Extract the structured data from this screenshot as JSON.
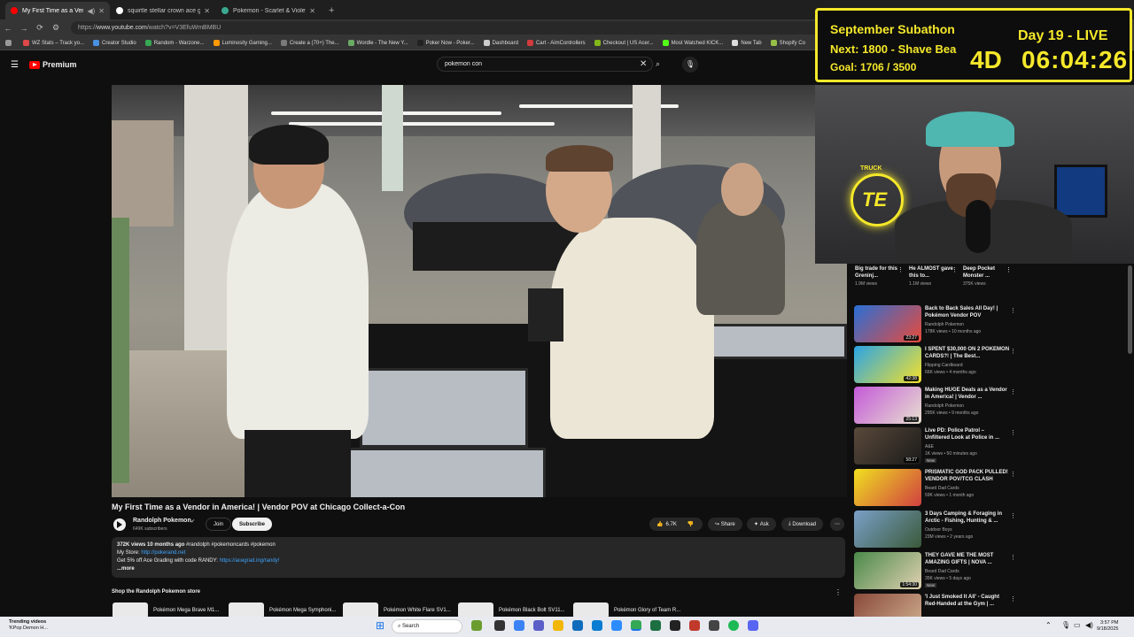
{
  "browser": {
    "tabs": [
      {
        "title": "My First Time as a Vendor in America!",
        "active": true,
        "color": "#ff0000"
      },
      {
        "title": "squirtle stellar crown ace grading",
        "active": false,
        "color": "#ffffff"
      },
      {
        "title": "Pokemon - Scarlet & Violet - Stellar",
        "active": false,
        "color": "#3aa88f"
      }
    ],
    "url_prefix": "https://",
    "url_main": "www.youtube.com",
    "url_rest": "/watch?v=V3EfuWmBMBU",
    "bookmarks": [
      {
        "label": "WZ Stats – Track yo...",
        "color": "#e04848"
      },
      {
        "label": "Creator Studio",
        "color": "#4a90e2"
      },
      {
        "label": "Random - Warzone...",
        "color": "#37a853"
      },
      {
        "label": "Luminosity Gaming...",
        "color": "#ff9a00"
      },
      {
        "label": "Create a (70+) The...",
        "color": "#7a7a7a"
      },
      {
        "label": "Wordle - The New Y...",
        "color": "#6aaa64"
      },
      {
        "label": "Poker Now - Poker...",
        "color": "#222222"
      },
      {
        "label": "Dashboard",
        "color": "#cccccc"
      },
      {
        "label": "Cart - AimControllers",
        "color": "#d23b3b"
      },
      {
        "label": "Checkout | US Acer...",
        "color": "#83b81a"
      },
      {
        "label": "Most Watched KICK...",
        "color": "#53fc18"
      },
      {
        "label": "New Tab",
        "color": "#dddddd"
      },
      {
        "label": "Shopify Co",
        "color": "#95bf47"
      }
    ]
  },
  "youtube": {
    "brand": "Premium",
    "search_value": "pokemon con",
    "video": {
      "title": "My First Time as a Vendor in America! | Vendor POV at Chicago Collect-a-Con",
      "channel": "Randolph Pokemon",
      "subscribers": "649K subscribers",
      "join": "Join",
      "subscribe": "Subscribe",
      "likes": "6.7K",
      "share": "Share",
      "ask": "Ask",
      "download": "Download"
    },
    "description": {
      "stats": "372K views  10 months ago",
      "tags": "  #randolph #pokemoncards #pokemon",
      "store_label": "My Store: ",
      "store_link": "http://pokerand.net",
      "promo": "Get 5% off Ace Grading with code RANDY: ",
      "promo_link": "https://acegrad.ing/randy!",
      "more": "...more"
    },
    "shop": {
      "title": "Shop the Randolph Pokemon store",
      "items": [
        "Pokémon Mega Brave M1...",
        "Pokémon Mega Symphoni...",
        "Pokémon White Flare SV1...",
        "Pokémon Black Bolt SV11...",
        "Pokémon Glory of Team R..."
      ]
    },
    "shorts": [
      {
        "title": "Big trade for this Greninj...",
        "views": "1.9M views"
      },
      {
        "title": "He ALMOST gave this to...",
        "views": "1.1M views"
      },
      {
        "title": "Deep Pocket Monster ...",
        "views": "375K views"
      }
    ],
    "recommendations": [
      {
        "title": "Back to Back Sales All Day! | Pokémon Vendor POV",
        "channel": "Randolph Pokemon",
        "meta": "178K views • 10 months ago",
        "duration": "23:27",
        "badge": "",
        "c1": "#2a6fd6",
        "c2": "#e84a3a"
      },
      {
        "title": "I SPENT $30,000 ON 2 POKEMON CARDS?! | The Best...",
        "channel": "Flipping Cardboard",
        "meta": "66K views • 4 months ago",
        "duration": "42:38",
        "badge": "",
        "c1": "#2aa4e6",
        "c2": "#f5e12a"
      },
      {
        "title": "Making HUGE Deals as a Vendor in America! | Vendor ...",
        "channel": "Randolph Pokemon",
        "meta": "295K views • 9 months ago",
        "duration": "25:13",
        "badge": "",
        "c1": "#c45ad8",
        "c2": "#e8e0d0"
      },
      {
        "title": "Live PD: Police Patrol – Unfiltered Look at Police in ...",
        "channel": "A&E",
        "meta": "1K views • 50 minutes ago",
        "duration": "58:27",
        "badge": "New",
        "c1": "#5a4a3a",
        "c2": "#1a1a1a"
      },
      {
        "title": "PRISMATIC GOD PACK PULLED! VENDOR POV/TCG CLASH",
        "channel": "Beard Dad Cards",
        "meta": "59K views • 1 month ago",
        "duration": "",
        "badge": "",
        "c1": "#f0e020",
        "c2": "#d04040"
      },
      {
        "title": "3 Days Camping & Foraging in Arctic - Fishing, Hunting & ...",
        "channel": "Outdoor Boys",
        "meta": "23M views • 2 years ago",
        "duration": "",
        "badge": "",
        "c1": "#7aa0c8",
        "c2": "#3a5a3a"
      },
      {
        "title": "THEY GAVE ME THE MOST AMAZING GIFTS | NOVA ...",
        "channel": "Beard Dad Cards",
        "meta": "35K views • 5 days ago",
        "duration": "1:54:30",
        "badge": "New",
        "c1": "#4a8a4a",
        "c2": "#e0d0b0"
      },
      {
        "title": "'I Just Smoked It All' - Caught Red-Handed at the Gym | ...",
        "channel": "",
        "meta": "",
        "duration": "",
        "badge": "",
        "c1": "#8a4a3a",
        "c2": "#d0b090"
      }
    ]
  },
  "overlay": {
    "title": "September Subathon",
    "next": "Next: 1800 - Shave Bea",
    "goal": "Goal: 1706 / 3500",
    "day": "Day 19 - LIVE",
    "days": "4D",
    "clock": "06:04:26",
    "accent": "#f5e82a",
    "logo_text": "TRUCK",
    "logo_initials": "TE"
  },
  "taskbar": {
    "news_title": "Trending videos",
    "news_sub": "'KPop Demon H...",
    "search": "Search",
    "time": "3:57 PM",
    "date": "9/18/2025"
  }
}
